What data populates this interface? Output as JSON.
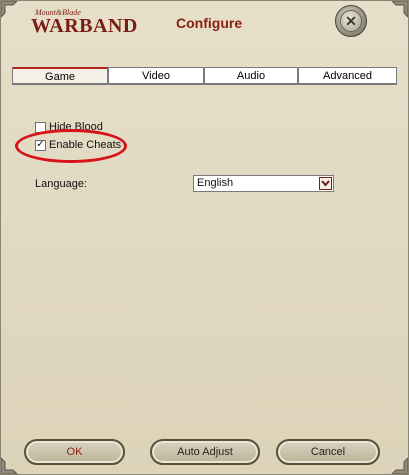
{
  "window": {
    "title": "Configure",
    "logo_small": "Mount&Blade",
    "logo_big": "WARBAND"
  },
  "tabs": [
    {
      "label": "Game",
      "active": true
    },
    {
      "label": "Video",
      "active": false
    },
    {
      "label": "Audio",
      "active": false
    },
    {
      "label": "Advanced",
      "active": false
    }
  ],
  "game": {
    "hide_blood": {
      "label": "Hide Blood",
      "checked": false
    },
    "enable_cheats": {
      "label": "Enable Cheats",
      "checked": true
    },
    "language": {
      "label": "Language:",
      "value": "English"
    }
  },
  "buttons": {
    "ok": "OK",
    "auto_adjust": "Auto Adjust",
    "cancel": "Cancel"
  },
  "colors": {
    "accent": "#8a1f14",
    "highlight_ring": "#d8121b",
    "background": "#e3dbc3"
  },
  "icons": {
    "close": "close-icon",
    "dropdown": "chevron-down-icon",
    "check": "checkmark-icon"
  }
}
